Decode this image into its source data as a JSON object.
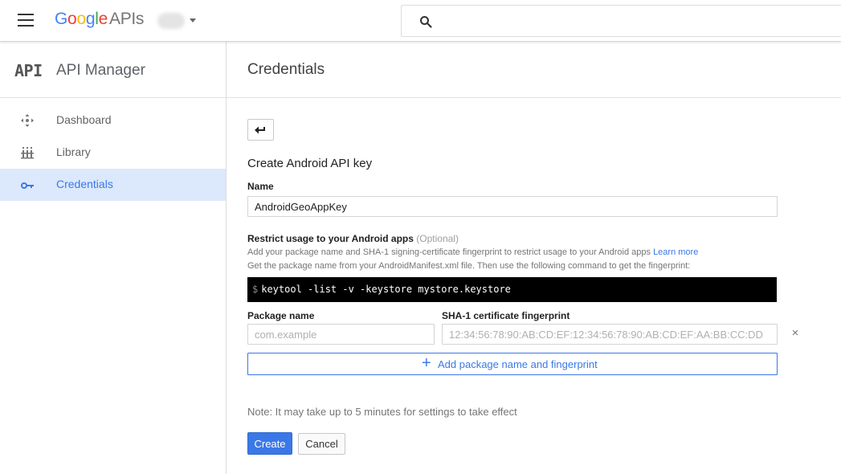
{
  "header": {
    "logo": {
      "G": "G",
      "o1": "o",
      "o2": "o",
      "g": "g",
      "l": "l",
      "e": "e",
      "apis": "APIs"
    },
    "search": {
      "value": "",
      "placeholder": ""
    }
  },
  "sidebar": {
    "logo_text": "API",
    "title": "API Manager",
    "items": [
      {
        "label": "Dashboard",
        "icon": "dashboard-icon",
        "active": false
      },
      {
        "label": "Library",
        "icon": "library-icon",
        "active": false
      },
      {
        "label": "Credentials",
        "icon": "key-icon",
        "active": true
      }
    ]
  },
  "main": {
    "title": "Credentials",
    "form": {
      "heading": "Create Android API key",
      "name_label": "Name",
      "name_value": "AndroidGeoAppKey",
      "restrict_label": "Restrict usage to your Android apps",
      "restrict_optional": "(Optional)",
      "help_line1": "Add your package name and SHA-1 signing-certificate fingerprint to restrict usage to your Android apps",
      "learn_more": "Learn more",
      "help_line2": "Get the package name from your AndroidManifest.xml file. Then use the following command to get the fingerprint:",
      "command_prompt": "$",
      "command": "keytool -list -v -keystore mystore.keystore",
      "package_label": "Package name",
      "package_placeholder": "com.example",
      "package_value": "",
      "sha_label": "SHA-1 certificate fingerprint",
      "sha_placeholder": "12:34:56:78:90:AB:CD:EF:12:34:56:78:90:AB:CD:EF:AA:BB:CC:DD",
      "sha_value": "",
      "remove_symbol": "×",
      "add_button": "Add package name and fingerprint",
      "add_symbol": "+",
      "note": "Note: It may take up to 5 minutes for settings to take effect",
      "create_button": "Create",
      "cancel_button": "Cancel"
    }
  },
  "colors": {
    "brand_blue": "#3b78e7",
    "active_nav_bg": "#dce8fb",
    "code_bg": "#000000"
  }
}
